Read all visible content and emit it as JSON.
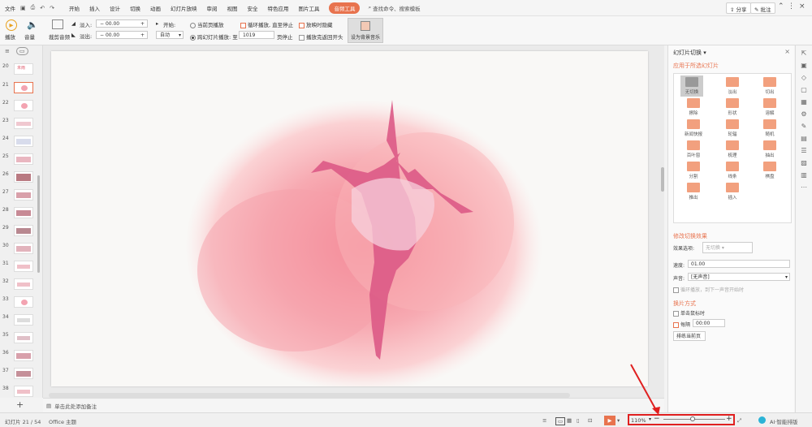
{
  "menu": {
    "file": "文件",
    "items": [
      "开始",
      "插入",
      "设计",
      "切换",
      "动画",
      "幻灯片放映",
      "审阅",
      "视图",
      "安全",
      "特色应用",
      "图片工具"
    ],
    "active": "音频工具",
    "search": "查找命令、搜索模板",
    "share": "分享",
    "comment": "批注"
  },
  "ribbon": {
    "play": "播放",
    "volume": "音量",
    "trim": "裁剪音频",
    "fade_in_label": "淡入:",
    "fade_in_value": "00.00",
    "fade_out_label": "淡出:",
    "fade_out_value": "00.00",
    "start_label": "开始:",
    "start_value": "自动",
    "current_page": "当前页播放",
    "across_slides": "跨幻灯片播放: 至",
    "page_value": "1019",
    "page_stop": "页停止",
    "loop": "循环播放, 直至停止",
    "hide_when": "放映时隐藏",
    "rewind": "播放完返回开头",
    "bg_music": "设为背景音乐"
  },
  "thumbs": [
    {
      "n": "20"
    },
    {
      "n": "21"
    },
    {
      "n": "22"
    },
    {
      "n": "23"
    },
    {
      "n": "24"
    },
    {
      "n": "25"
    },
    {
      "n": "26"
    },
    {
      "n": "27"
    },
    {
      "n": "28"
    },
    {
      "n": "29"
    },
    {
      "n": "30"
    },
    {
      "n": "31"
    },
    {
      "n": "32"
    },
    {
      "n": "33"
    },
    {
      "n": "34"
    },
    {
      "n": "35"
    },
    {
      "n": "36"
    },
    {
      "n": "37"
    },
    {
      "n": "38"
    }
  ],
  "thumb_text": "未雨",
  "notes": "单击此处添加备注",
  "status": {
    "slide": "幻灯片 21 / 54",
    "theme": "Office 主题",
    "zoom": "110%",
    "ai": "AI·智能排版"
  },
  "pane": {
    "title": "幻灯片切换",
    "apply": "应用于所选幻灯片",
    "transitions": [
      "无切换",
      "淡出",
      "切出",
      "擦除",
      "形状",
      "溶解",
      "新闻快报",
      "轮辐",
      "随机",
      "百叶窗",
      "梳理",
      "抽出",
      "分割",
      "线条",
      "棋盘",
      "推出",
      "插入"
    ],
    "modify": "修改切换效果",
    "effect_label": "效果选项:",
    "effect_value": "无切换",
    "speed_label": "速度:",
    "speed_value": "01.00",
    "sound_label": "声音:",
    "sound_value": "[无声音]",
    "loop_sound": "循环播放，到下一声音开始时",
    "advance": "换片方式",
    "on_click": "单击鼠标时",
    "every": "每隔",
    "every_value": "00:00",
    "apply_all": "排练当前页"
  },
  "colors": {
    "accent": "#e8734e",
    "slide_bg": "#f9f8f6"
  }
}
